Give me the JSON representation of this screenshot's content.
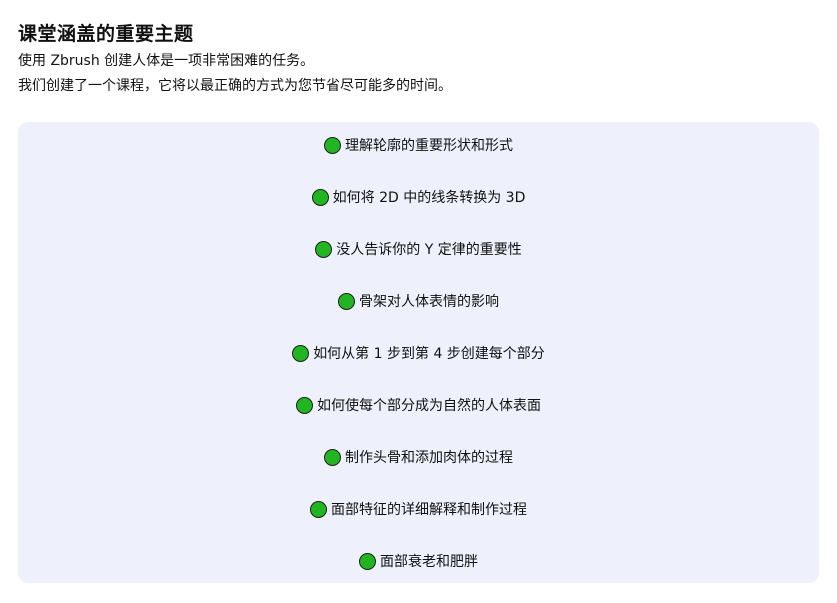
{
  "heading": "课堂涵盖的重要主题",
  "intro": [
    "使用 Zbrush 创建人体是一项非常困难的任务。",
    "我们创建了一个课程，它将以最正确的方式为您节省尽可能多的时间。"
  ],
  "topics": [
    "理解轮廓的重要形状和形式",
    "如何将 2D 中的线条转换为 3D",
    "没人告诉你的 Y 定律的重要性",
    "骨架对人体表情的影响",
    "如何从第 1 步到第 4 步创建每个部分",
    "如何使每个部分成为自然的人体表面",
    "制作头骨和添加肉体的过程",
    "面部特征的详细解释和制作过程",
    "面部衰老和肥胖"
  ],
  "colors": {
    "bullet": "#22b522",
    "panel_background": "#eef1fb"
  },
  "icons": {
    "bullet": "green-dot-icon"
  }
}
